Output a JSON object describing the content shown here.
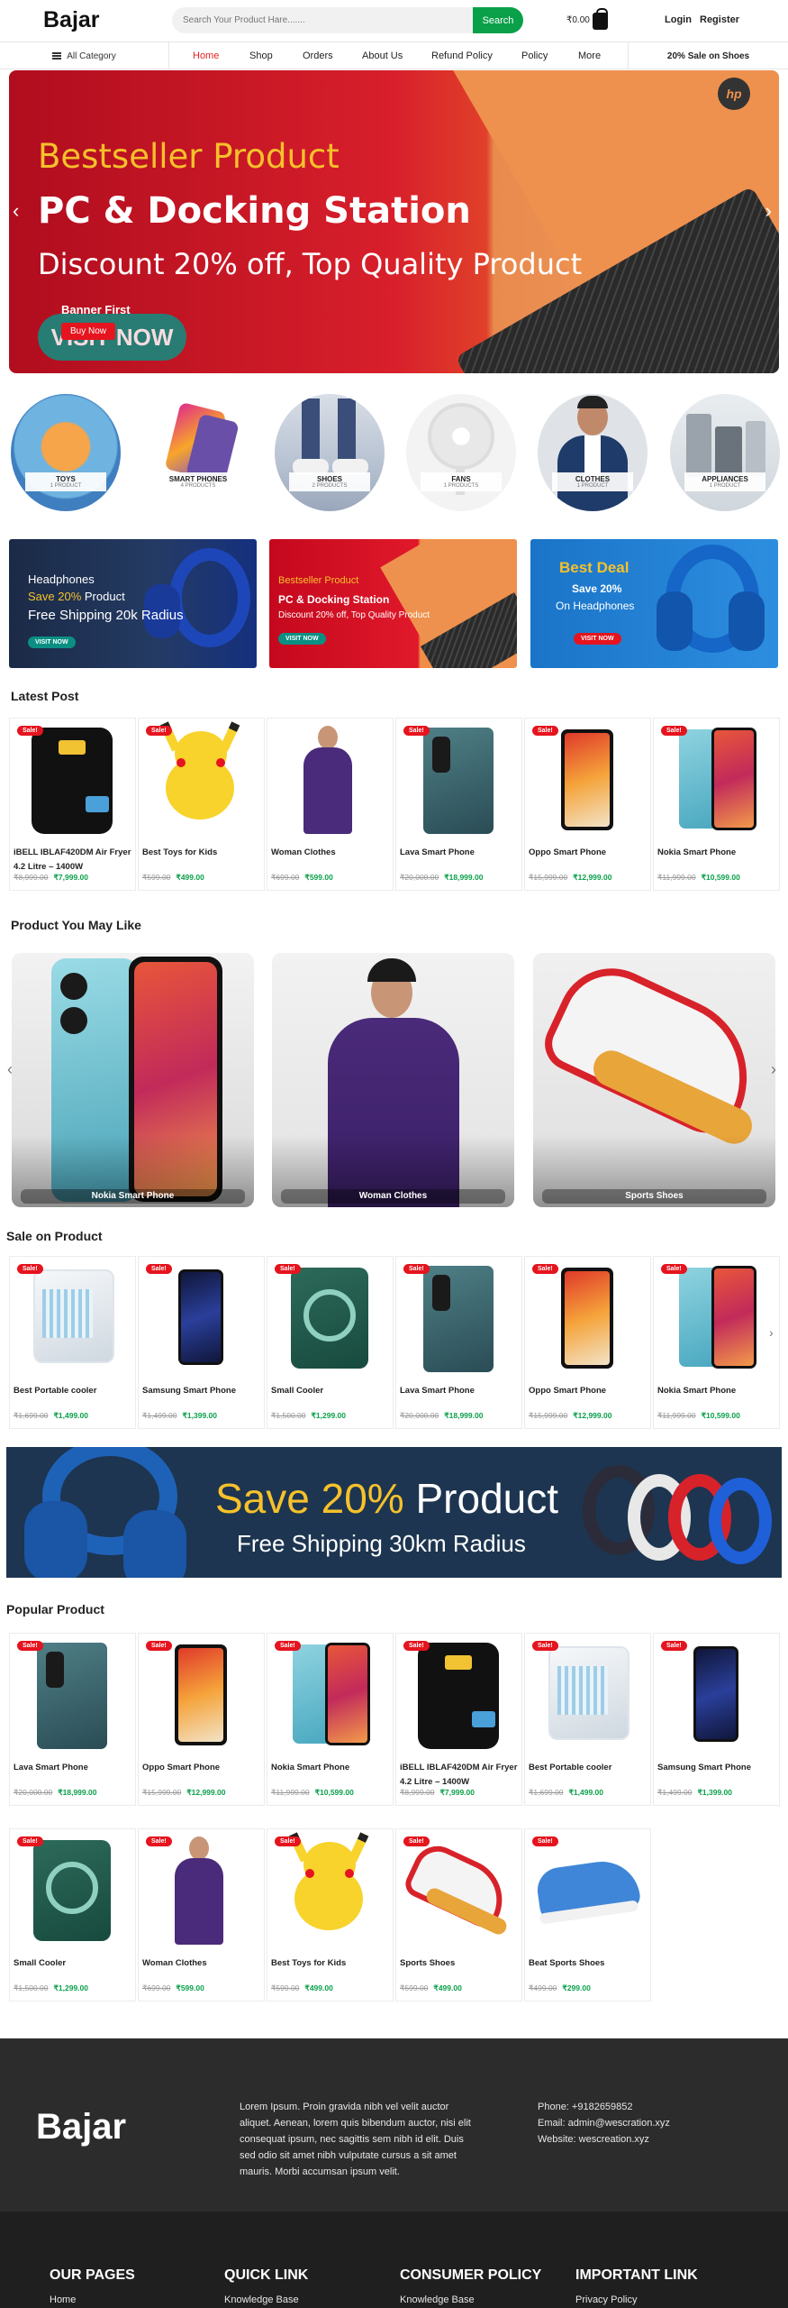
{
  "header": {
    "logo": "Bajar",
    "search_placeholder": "Search Your Product Hare.......",
    "search_button": "Search",
    "cart_amount": "₹0.00",
    "login": "Login",
    "register": "Register"
  },
  "nav": {
    "all_category": "All Category",
    "items": [
      "Home",
      "Shop",
      "Orders",
      "About Us",
      "Refund Policy",
      "Policy",
      "More"
    ],
    "active": "Home",
    "sale_link": "20% Sale on Shoes"
  },
  "hero": {
    "line1": "Bestseller Product",
    "line2": "PC & Docking Station",
    "line3": "Discount 20% off, Top Quality Product",
    "pill_text": "VISIT NOW",
    "caption_title": "Banner First",
    "cta": "Buy Now",
    "brand": "hp"
  },
  "categories": [
    {
      "name": "TOYS",
      "count": "1 PRODUCT"
    },
    {
      "name": "SMART PHONES",
      "count": "4 PRODUCTS"
    },
    {
      "name": "SHOES",
      "count": "2 PRODUCTS"
    },
    {
      "name": "FANS",
      "count": "1 PRODUCTS"
    },
    {
      "name": "CLOTHES",
      "count": "1 PRODUCT"
    },
    {
      "name": "APPLIANCES",
      "count": "1 PRODUCT"
    }
  ],
  "promos": [
    {
      "line1": "Headphones",
      "line2_accent": "Save 20%",
      "line2_rest": " Product",
      "line3": "Free Shipping 20k Radius",
      "button": "VISIT NOW"
    },
    {
      "line1": "Bestseller Product",
      "line2": "PC & Docking Station",
      "line3": "Discount 20% off, Top Quality Product",
      "button": "VISIT NOW"
    },
    {
      "line1": "Best Deal",
      "line2": "Save 20%",
      "line3": "On Headphones",
      "button": "VISIT NOW"
    }
  ],
  "sections": {
    "latest": "Latest Post",
    "like": "Product You May Like",
    "sale": "Sale on Product",
    "popular": "Popular Product"
  },
  "badge": "Sale!",
  "latest_products": [
    {
      "name": "iBELL IBLAF420DM Air Fryer 4.2 Litre – 1400W",
      "old": "₹8,999.00",
      "new": "₹7,999.00"
    },
    {
      "name": "Best Toys for Kids",
      "old": "₹599.00",
      "new": "₹499.00"
    },
    {
      "name": "Woman Clothes",
      "old": "₹699.00",
      "new": "₹599.00"
    },
    {
      "name": "Lava Smart Phone",
      "old": "₹20,000.00",
      "new": "₹18,999.00"
    },
    {
      "name": "Oppo Smart Phone",
      "old": "₹15,999.00",
      "new": "₹12,999.00"
    },
    {
      "name": "Nokia Smart Phone",
      "old": "₹11,999.00",
      "new": "₹10,599.00"
    }
  ],
  "like_products": [
    "Nokia Smart Phone",
    "Woman Clothes",
    "Sports Shoes"
  ],
  "sale_products": [
    {
      "name": "Best Portable cooler",
      "old": "₹1,699.00",
      "new": "₹1,499.00"
    },
    {
      "name": "Samsung Smart Phone",
      "old": "₹1,499.00",
      "new": "₹1,399.00"
    },
    {
      "name": "Small Cooler",
      "old": "₹1,500.00",
      "new": "₹1,299.00"
    },
    {
      "name": "Lava Smart Phone",
      "old": "₹20,000.00",
      "new": "₹18,999.00"
    },
    {
      "name": "Oppo Smart Phone",
      "old": "₹15,999.00",
      "new": "₹12,999.00"
    },
    {
      "name": "Nokia Smart Phone",
      "old": "₹11,999.00",
      "new": "₹10,599.00"
    }
  ],
  "big_banner": {
    "accent": "Save 20%",
    "rest": " Product",
    "line2": "Free Shipping 30km Radius"
  },
  "popular_products": [
    {
      "name": "Lava Smart Phone",
      "old": "₹20,000.00",
      "new": "₹18,999.00"
    },
    {
      "name": "Oppo Smart Phone",
      "old": "₹15,999.00",
      "new": "₹12,999.00"
    },
    {
      "name": "Nokia Smart Phone",
      "old": "₹11,999.00",
      "new": "₹10,599.00"
    },
    {
      "name": "iBELL IBLAF420DM Air Fryer 4.2 Litre – 1400W",
      "old": "₹8,999.00",
      "new": "₹7,999.00"
    },
    {
      "name": "Best Portable cooler",
      "old": "₹1,699.00",
      "new": "₹1,499.00"
    },
    {
      "name": "Samsung Smart Phone",
      "old": "₹1,499.00",
      "new": "₹1,399.00"
    },
    {
      "name": "Small Cooler",
      "old": "₹1,500.00",
      "new": "₹1,299.00"
    },
    {
      "name": "Woman Clothes",
      "old": "₹699.00",
      "new": "₹599.00"
    },
    {
      "name": "Best Toys for Kids",
      "old": "₹599.00",
      "new": "₹499.00"
    },
    {
      "name": "Sports Shoes",
      "old": "₹599.00",
      "new": "₹499.00"
    },
    {
      "name": "Beat Sports Shoes",
      "old": "₹499.00",
      "new": "₹299.00"
    }
  ],
  "footer": {
    "logo": "Bajar",
    "description": "Lorem Ipsum. Proin gravida nibh vel velit auctor aliquet. Aenean, lorem quis bibendum auctor, nisi elit consequat ipsum, nec sagittis sem nibh id elit. Duis sed odio sit amet nibh vulputate cursus a sit amet mauris. Morbi accumsan ipsum velit.",
    "phone": "Phone: +9182659852",
    "email": "Email: admin@wescration.xyz",
    "website": "Website: wescreation.xyz",
    "columns": [
      {
        "title": "OUR PAGES",
        "link": "Home"
      },
      {
        "title": "QUICK LINK",
        "link": "Knowledge Base"
      },
      {
        "title": "CONSUMER POLICY",
        "link": "Knowledge Base"
      },
      {
        "title": "IMPORTANT LINK",
        "link": "Privacy Policy"
      }
    ]
  },
  "colors": {
    "accent_green": "#0aa04a",
    "accent_red": "#e5141e",
    "footer_dark": "#2c2c2c"
  }
}
